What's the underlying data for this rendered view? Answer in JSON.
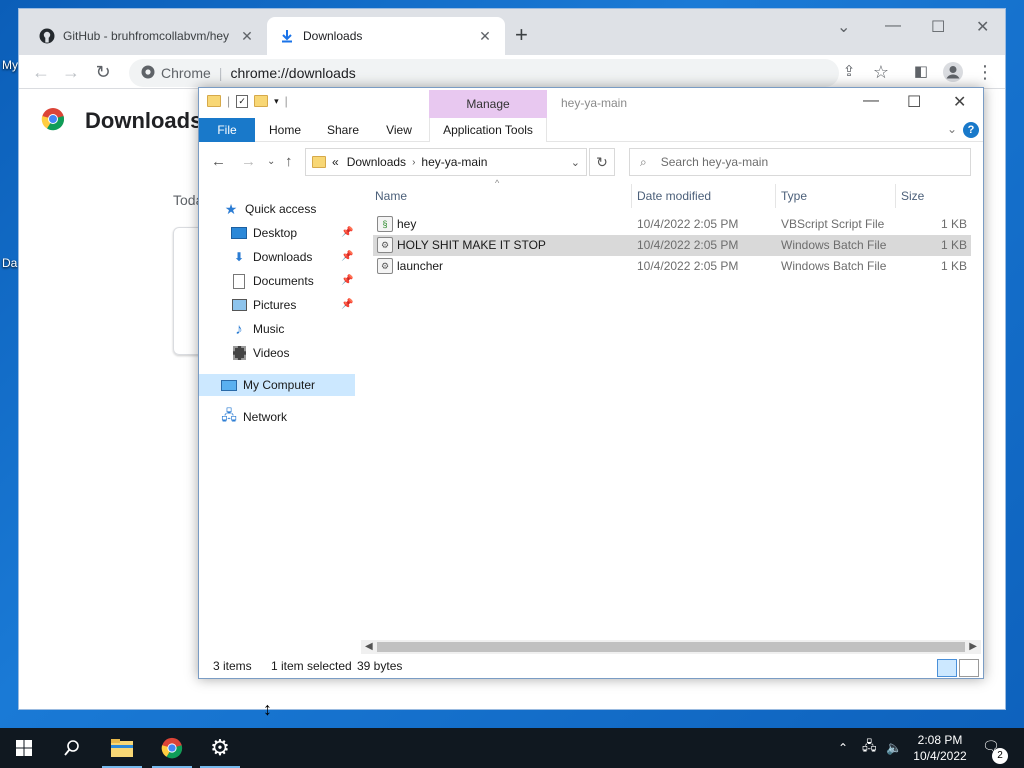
{
  "desktop": {
    "label_my": "My",
    "label_da": "Da"
  },
  "chrome": {
    "tabs": [
      {
        "title": "GitHub - bruhfromcollabvm/hey",
        "icon": "github-icon"
      },
      {
        "title": "Downloads",
        "icon": "download-icon"
      }
    ],
    "omnibox": {
      "site": "Chrome",
      "url": "chrome://downloads"
    },
    "page_title": "Downloads",
    "section_label": "Toda"
  },
  "explorer": {
    "title": "hey-ya-main",
    "manage_label": "Manage",
    "ribbon": {
      "file": "File",
      "home": "Home",
      "share": "Share",
      "view": "View",
      "app_tools": "Application Tools"
    },
    "address": {
      "crumbs": [
        "Downloads",
        "hey-ya-main"
      ],
      "overflow": "«"
    },
    "search_placeholder": "Search hey-ya-main",
    "nav": {
      "quick_access": "Quick access",
      "desktop": "Desktop",
      "downloads": "Downloads",
      "documents": "Documents",
      "pictures": "Pictures",
      "music": "Music",
      "videos": "Videos",
      "my_computer": "My Computer",
      "network": "Network"
    },
    "columns": {
      "name": "Name",
      "date": "Date modified",
      "type": "Type",
      "size": "Size"
    },
    "files": [
      {
        "name": "hey",
        "date": "10/4/2022 2:05 PM",
        "type": "VBScript Script File",
        "size": "1 KB",
        "selected": false
      },
      {
        "name": "HOLY SHIT MAKE IT STOP",
        "date": "10/4/2022 2:05 PM",
        "type": "Windows Batch File",
        "size": "1 KB",
        "selected": true
      },
      {
        "name": "launcher",
        "date": "10/4/2022 2:05 PM",
        "type": "Windows Batch File",
        "size": "1 KB",
        "selected": false
      }
    ],
    "status": {
      "items": "3 items",
      "selected": "1 item selected",
      "bytes": "39 bytes"
    }
  },
  "taskbar": {
    "apps": [
      "start-icon",
      "search-icon",
      "file-explorer-icon",
      "chrome-icon",
      "settings-icon"
    ],
    "time": "2:08 PM",
    "date": "10/4/2022",
    "notification_count": "2"
  }
}
